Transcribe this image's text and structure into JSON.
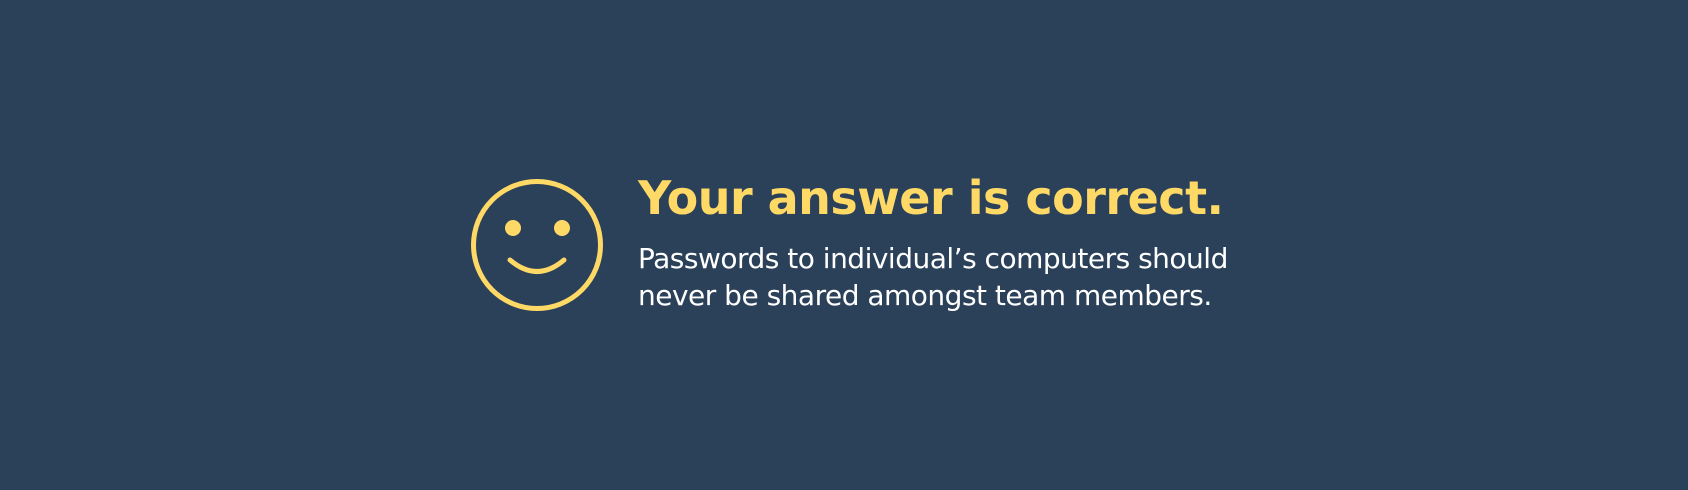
{
  "feedback": {
    "icon": "smiley-face-icon",
    "title": "Your answer is correct.",
    "message_line1": "Passwords to individual’s computers should",
    "message_line2": "never be shared amongst team members."
  },
  "colors": {
    "background": "#2b4159",
    "accent": "#ffd966",
    "text": "#ffffff"
  }
}
